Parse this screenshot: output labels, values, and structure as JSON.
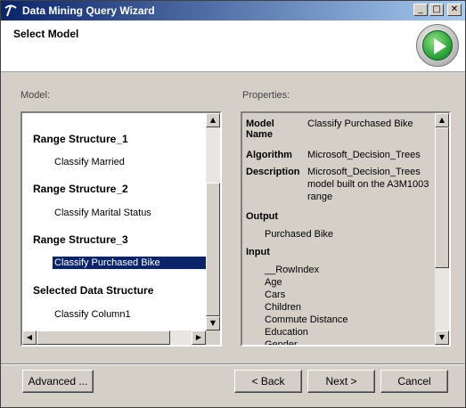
{
  "window": {
    "title": "Data Mining Query Wizard"
  },
  "header": {
    "title": "Select Model",
    "go_icon": "green-arrow-icon"
  },
  "model_panel": {
    "label": "Model:",
    "items": [
      {
        "type": "group",
        "label": "Range Structure_1"
      },
      {
        "type": "child",
        "label": "Classify Married"
      },
      {
        "type": "group",
        "label": "Range Structure_2"
      },
      {
        "type": "child",
        "label": "Classify Marital Status"
      },
      {
        "type": "group",
        "label": "Range Structure_3"
      },
      {
        "type": "child",
        "label": "Classify Purchased Bike",
        "selected": true
      },
      {
        "type": "group",
        "label": "Selected Data Structure"
      },
      {
        "type": "child",
        "label": "Classify Column1"
      }
    ]
  },
  "properties_panel": {
    "label": "Properties:",
    "model_name_key": "Model Name",
    "model_name_value": "Classify Purchased Bike",
    "algorithm_key": "Algorithm",
    "algorithm_value": "Microsoft_Decision_Trees",
    "description_key": "Description",
    "description_value_1": "Microsoft_Decision_Trees",
    "description_value_2": "model built on the A3M1003",
    "description_value_3": "range",
    "output_key": "Output",
    "output_values": [
      "Purchased Bike"
    ],
    "input_key": "Input",
    "input_values": [
      "__RowIndex",
      "Age",
      "Cars",
      "Children",
      "Commute Distance",
      "Education",
      "Gender"
    ]
  },
  "buttons": {
    "advanced": "Advanced ...",
    "back": "< Back",
    "next": "Next >",
    "cancel": "Cancel"
  },
  "titlebar_buttons": {
    "minimize": "_",
    "maximize": "□",
    "close": "✕"
  }
}
